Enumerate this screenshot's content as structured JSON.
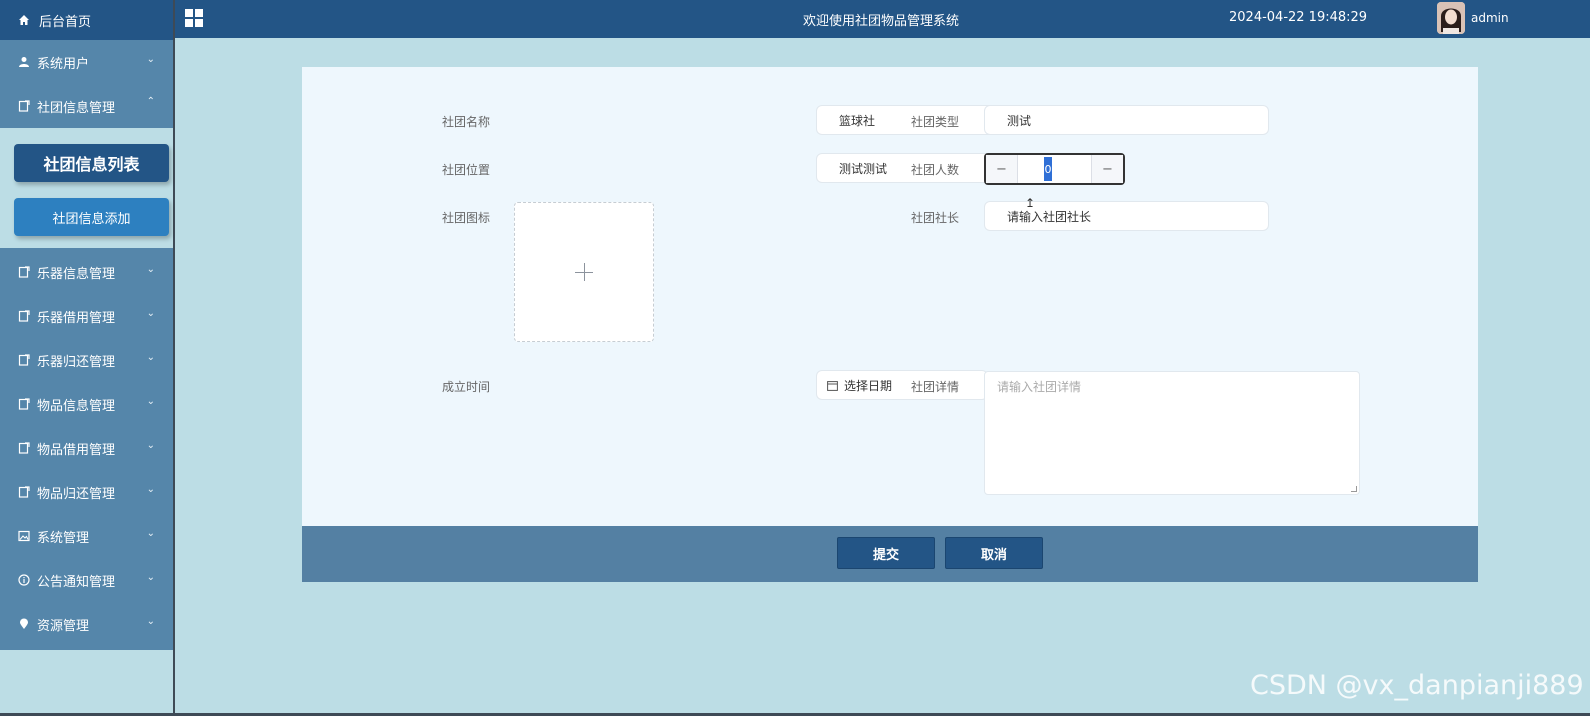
{
  "sidebar": {
    "home_label": "后台首页",
    "items": [
      {
        "label": "系统用户"
      },
      {
        "label": "社团信息管理"
      },
      {
        "label": "乐器信息管理"
      },
      {
        "label": "乐器借用管理"
      },
      {
        "label": "乐器归还管理"
      },
      {
        "label": "物品信息管理"
      },
      {
        "label": "物品借用管理"
      },
      {
        "label": "物品归还管理"
      },
      {
        "label": "系统管理"
      },
      {
        "label": "公告通知管理"
      },
      {
        "label": "资源管理"
      }
    ],
    "submenu": {
      "active_label": "社团信息列表",
      "normal_label": "社团信息添加"
    }
  },
  "topbar": {
    "title": "欢迎使用社团物品管理系统",
    "datetime": "2024-04-22 19:48:29",
    "username": "admin"
  },
  "form": {
    "name_label": "社团名称",
    "name_value": "篮球社",
    "type_label": "社团类型",
    "type_value": "测试",
    "location_label": "社团位置",
    "location_value": "测试测试",
    "count_label": "社团人数",
    "count_value": "0",
    "icon_label": "社团图标",
    "leader_label": "社团社长",
    "leader_value": "请输入社团社长",
    "date_label": "成立时间",
    "date_placeholder": "选择日期",
    "detail_label": "社团详情",
    "detail_placeholder": "请输入社团详情"
  },
  "actions": {
    "submit_label": "提交",
    "cancel_label": "取消"
  },
  "watermark": "CSDN @vx_danpianji889",
  "colors": {
    "header": "#235586",
    "sidebar": "#5586aa",
    "background": "#bcdde5",
    "card": "#eef7fd",
    "footer": "#5480a3"
  }
}
